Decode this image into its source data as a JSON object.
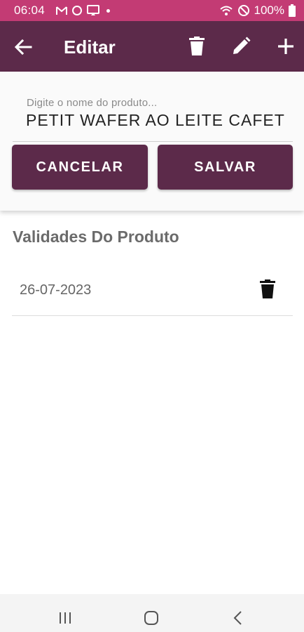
{
  "status_bar": {
    "time": "06:04",
    "battery": "100%",
    "icons_left": [
      "gmail-icon",
      "circle-icon",
      "cast-icon",
      "dot"
    ],
    "icons_right": [
      "wifi-icon",
      "do-not-disturb-icon",
      "battery-icon"
    ]
  },
  "app_bar": {
    "title": "Editar",
    "background": "#5c2a4a",
    "actions": [
      "delete-icon",
      "edit-icon",
      "add-icon"
    ]
  },
  "edit_form": {
    "name_label": "Digite o nome do produto...",
    "name_value": "PETIT WAFER AO LEITE CAFET",
    "cancel_label": "CANCELAR",
    "save_label": "SALVAR"
  },
  "validities": {
    "title": "Validades Do Produto",
    "items": [
      {
        "date": "26-07-2023"
      }
    ]
  },
  "colors": {
    "status_bar": "#c33b74",
    "primary": "#5c2a4a",
    "card": "#fafafa"
  }
}
